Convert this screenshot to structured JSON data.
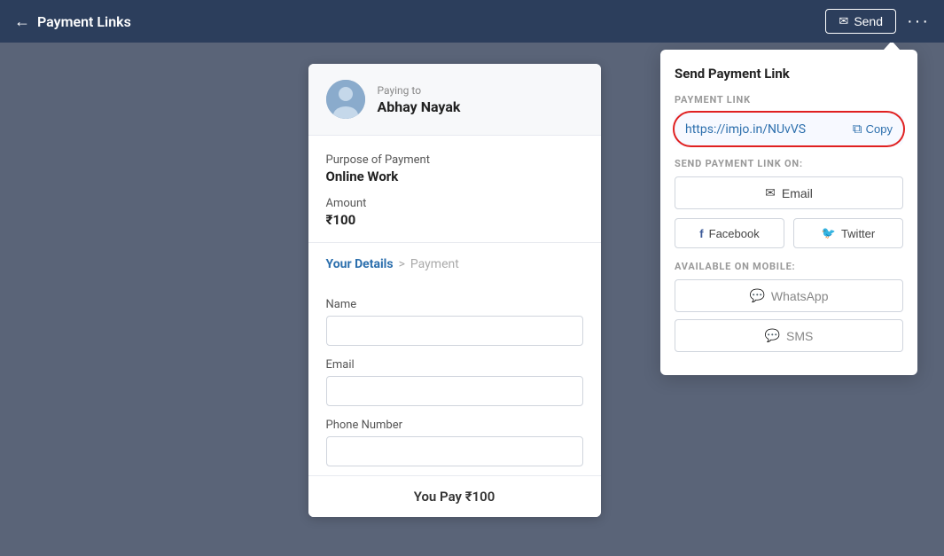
{
  "header": {
    "back_label": "Payment Links",
    "send_label": "Send",
    "more_icon": "···"
  },
  "payment_card": {
    "payee_section": {
      "paying_to_label": "Paying to",
      "payee_name": "Abhay Nayak"
    },
    "purpose_label": "Purpose of Payment",
    "purpose_value": "Online Work",
    "amount_label": "Amount",
    "amount_value": "₹100",
    "steps": {
      "active": "Your Details",
      "separator": ">",
      "inactive": "Payment"
    },
    "fields": [
      {
        "label": "Name",
        "placeholder": ""
      },
      {
        "label": "Email",
        "placeholder": ""
      },
      {
        "label": "Phone Number",
        "placeholder": ""
      }
    ],
    "footer": "You Pay ₹100"
  },
  "send_panel": {
    "title": "Send Payment Link",
    "link_section_label": "PAYMENT LINK",
    "link_url": "https://imjo.in/NUvVS",
    "copy_label": "Copy",
    "send_on_label": "SEND PAYMENT LINK ON:",
    "email_label": "Email",
    "facebook_label": "Facebook",
    "twitter_label": "Twitter",
    "mobile_label": "AVAILABLE ON MOBILE:",
    "whatsapp_label": "WhatsApp",
    "sms_label": "SMS"
  }
}
